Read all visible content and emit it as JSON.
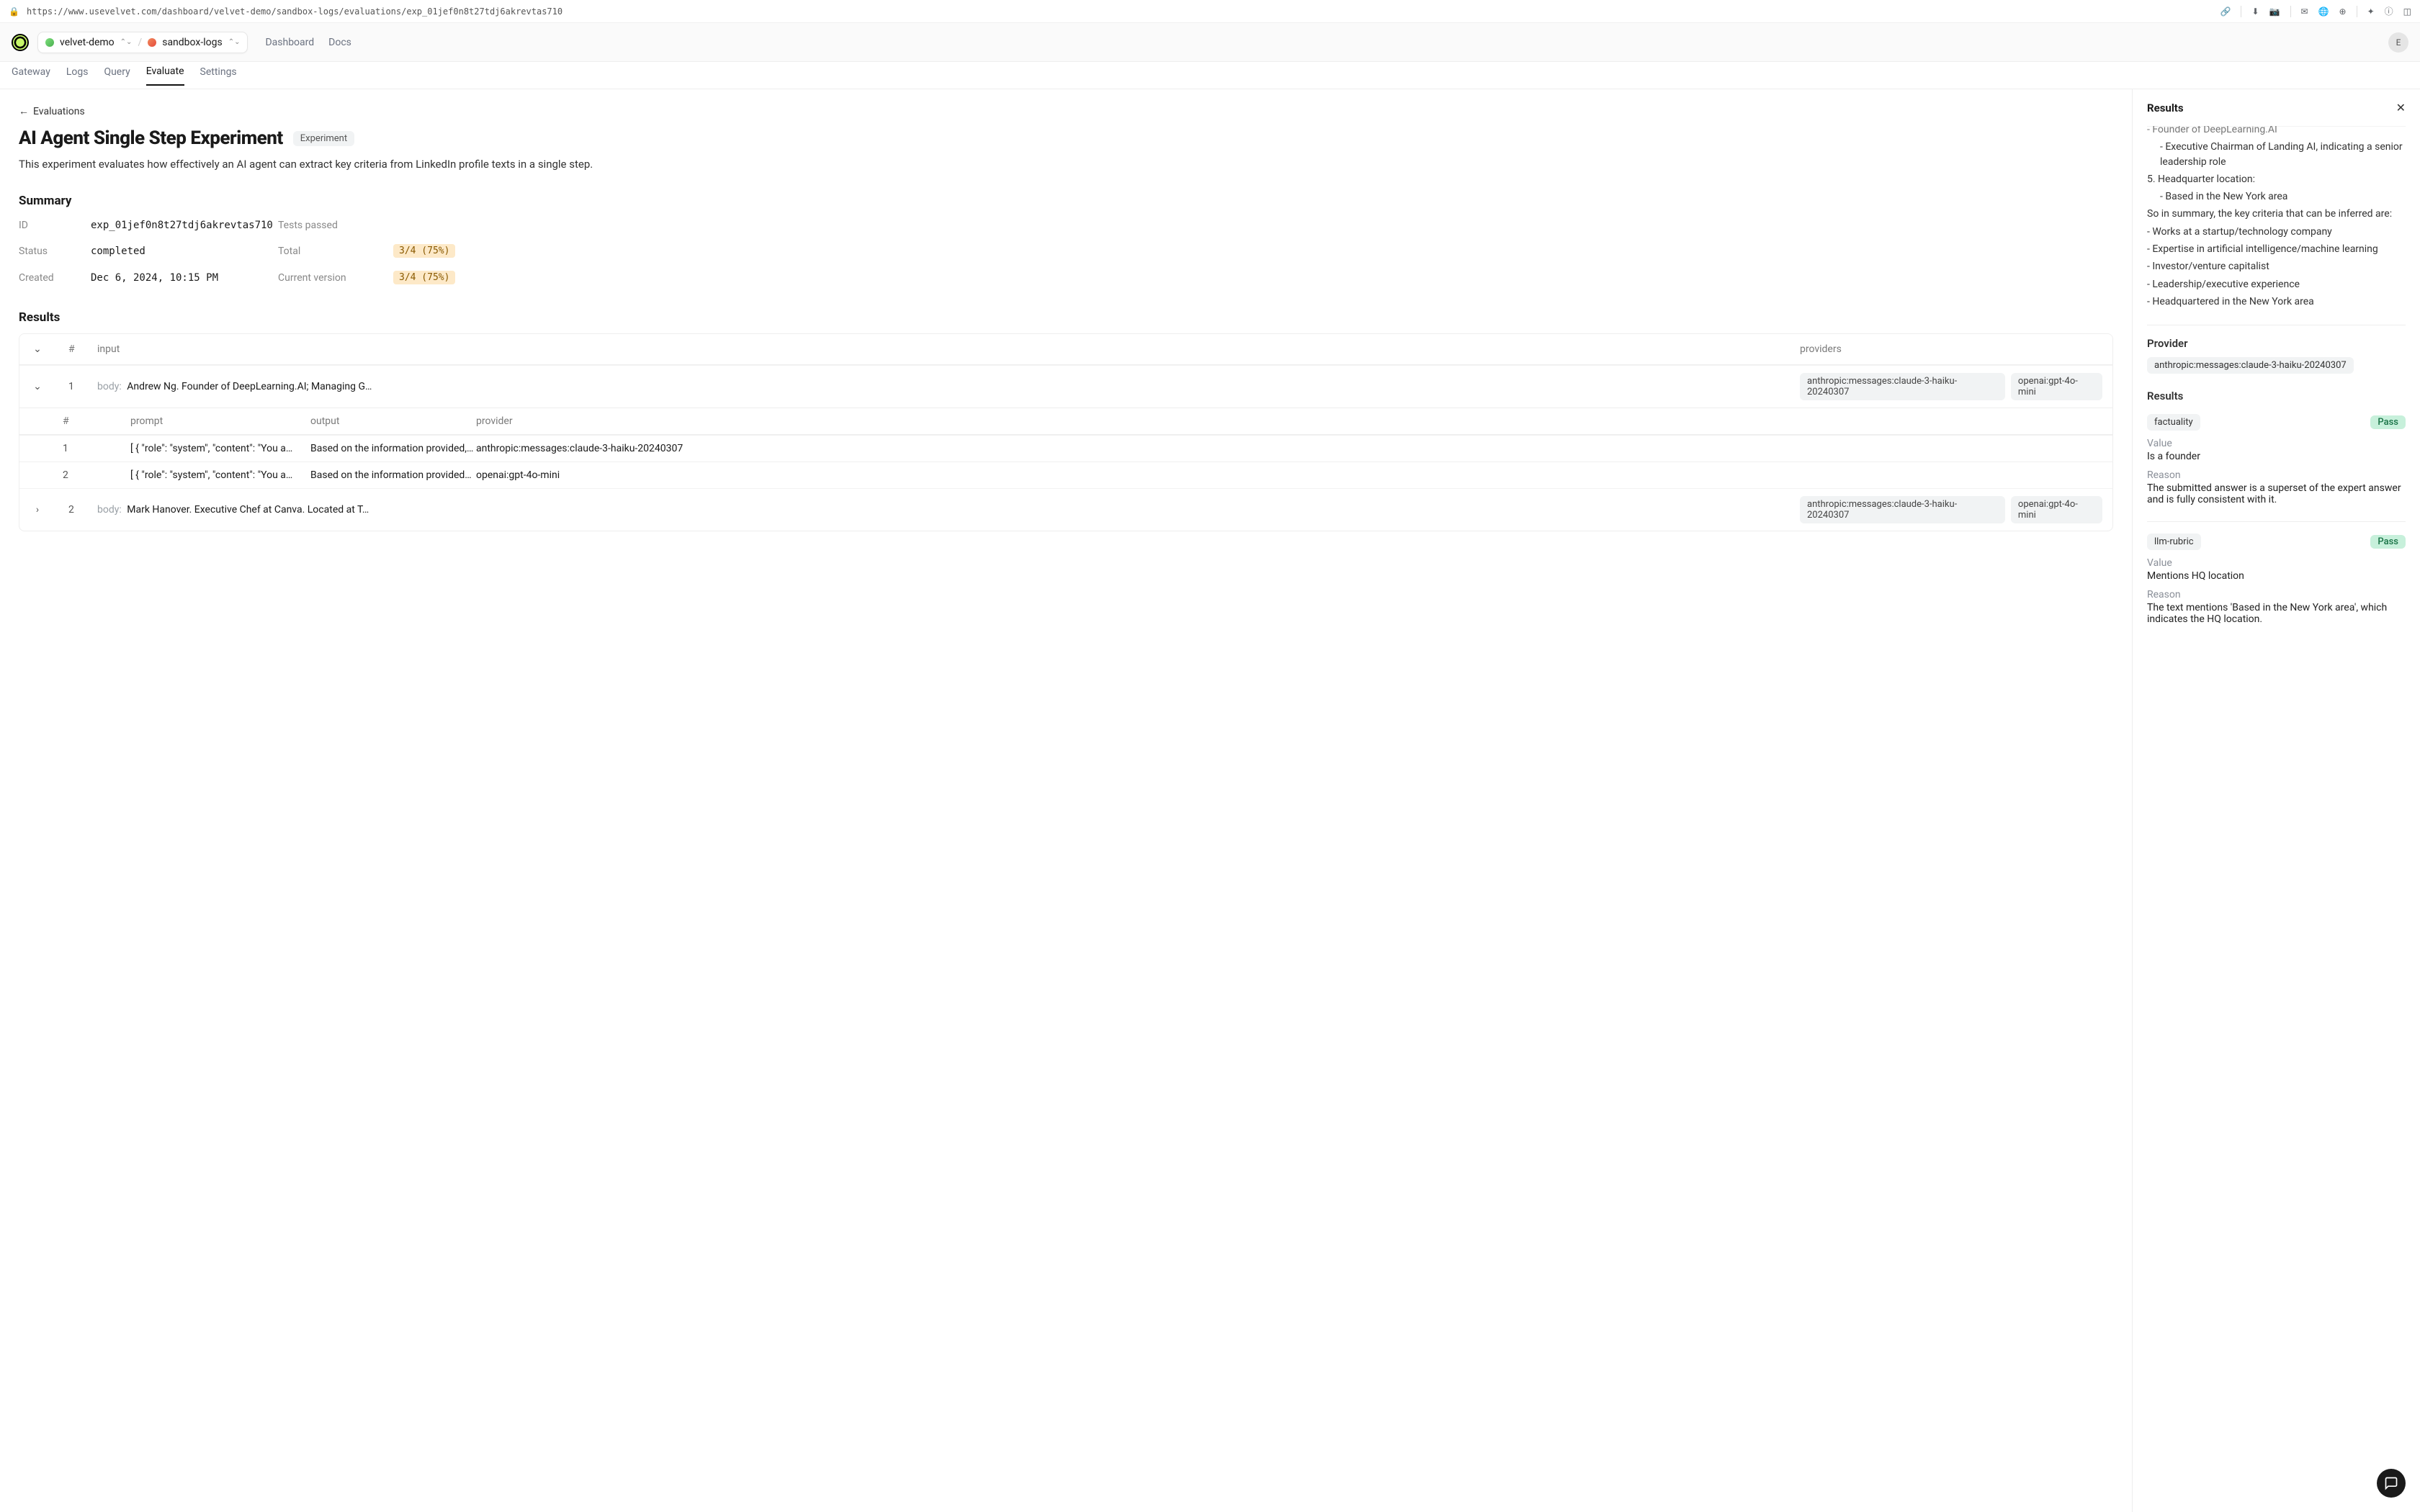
{
  "url": "https://www.usevelvet.com/dashboard/velvet-demo/sandbox-logs/evaluations/exp_01jef0n8t27tdj6akrevtas710",
  "project": "velvet-demo",
  "collection": "sandbox-logs",
  "nav": {
    "dashboard": "Dashboard",
    "docs": "Docs"
  },
  "avatar": "E",
  "tabs": [
    "Gateway",
    "Logs",
    "Query",
    "Evaluate",
    "Settings"
  ],
  "active_tab": "Evaluate",
  "back_label": "Evaluations",
  "title": "AI Agent Single Step Experiment",
  "title_badge": "Experiment",
  "description": "This experiment evaluates how effectively an AI agent can extract key criteria from LinkedIn profile texts in a single step.",
  "summary_heading": "Summary",
  "summary": {
    "id_label": "ID",
    "id": "exp_01jef0n8t27tdj6akrevtas710",
    "status_label": "Status",
    "status": "completed",
    "created_label": "Created",
    "created": "Dec 6, 2024, 10:15 PM",
    "tests_passed_label": "Tests passed",
    "total_label": "Total",
    "total": "3/4 (75%)",
    "current_version_label": "Current version",
    "current_version": "3/4 (75%)"
  },
  "results_heading": "Results",
  "outer_headers": {
    "num": "#",
    "input": "input",
    "providers": "providers"
  },
  "inner_headers": {
    "num": "#",
    "prompt": "prompt",
    "output": "output",
    "provider": "provider"
  },
  "rows": [
    {
      "idx": "1",
      "body_prefix": "body: ",
      "body": "Andrew Ng. Founder of DeepLearning.AI; Managing G…",
      "providers": [
        "anthropic:messages:claude-3-haiku-20240307",
        "openai:gpt-4o-mini"
      ],
      "expanded": true,
      "children": [
        {
          "idx": "1",
          "prompt": "[ { \"role\": \"system\", \"content\": \"You a…",
          "output": "Based on the information provided,…",
          "provider": "anthropic:messages:claude-3-haiku-20240307"
        },
        {
          "idx": "2",
          "prompt": "[ { \"role\": \"system\", \"content\": \"You a…",
          "output": "Based on the information provided…",
          "provider": "openai:gpt-4o-mini"
        }
      ]
    },
    {
      "idx": "2",
      "body_prefix": "body: ",
      "body": "Mark Hanover. Executive Chef at Canva. Located at T…",
      "providers": [
        "anthropic:messages:claude-3-haiku-20240307",
        "openai:gpt-4o-mini"
      ],
      "expanded": false
    }
  ],
  "side": {
    "heading": "Results",
    "pre_lines": [
      "    - Founder of DeepLearning.AI",
      "    - Executive Chairman of Landing AI, indicating a senior leadership role",
      "",
      "5. Headquarter location:",
      "    - Based in the New York area",
      "",
      "So in summary, the key criteria that can be inferred are:",
      "- Works at a startup/technology company",
      "- Expertise in artificial intelligence/machine learning",
      "- Investor/venture capitalist",
      "- Leadership/executive experience",
      "- Headquartered in the New York area"
    ],
    "provider_label": "Provider",
    "provider": "anthropic:messages:claude-3-haiku-20240307",
    "results_label": "Results",
    "evals": [
      {
        "name": "factuality",
        "status": "Pass",
        "value_label": "Value",
        "value": "Is a founder",
        "reason_label": "Reason",
        "reason": "The submitted answer is a superset of the expert answer and is fully consistent with it."
      },
      {
        "name": "llm-rubric",
        "status": "Pass",
        "value_label": "Value",
        "value": "Mentions HQ location",
        "reason_label": "Reason",
        "reason": "The text mentions 'Based in the New York area', which indicates the HQ location."
      }
    ]
  }
}
